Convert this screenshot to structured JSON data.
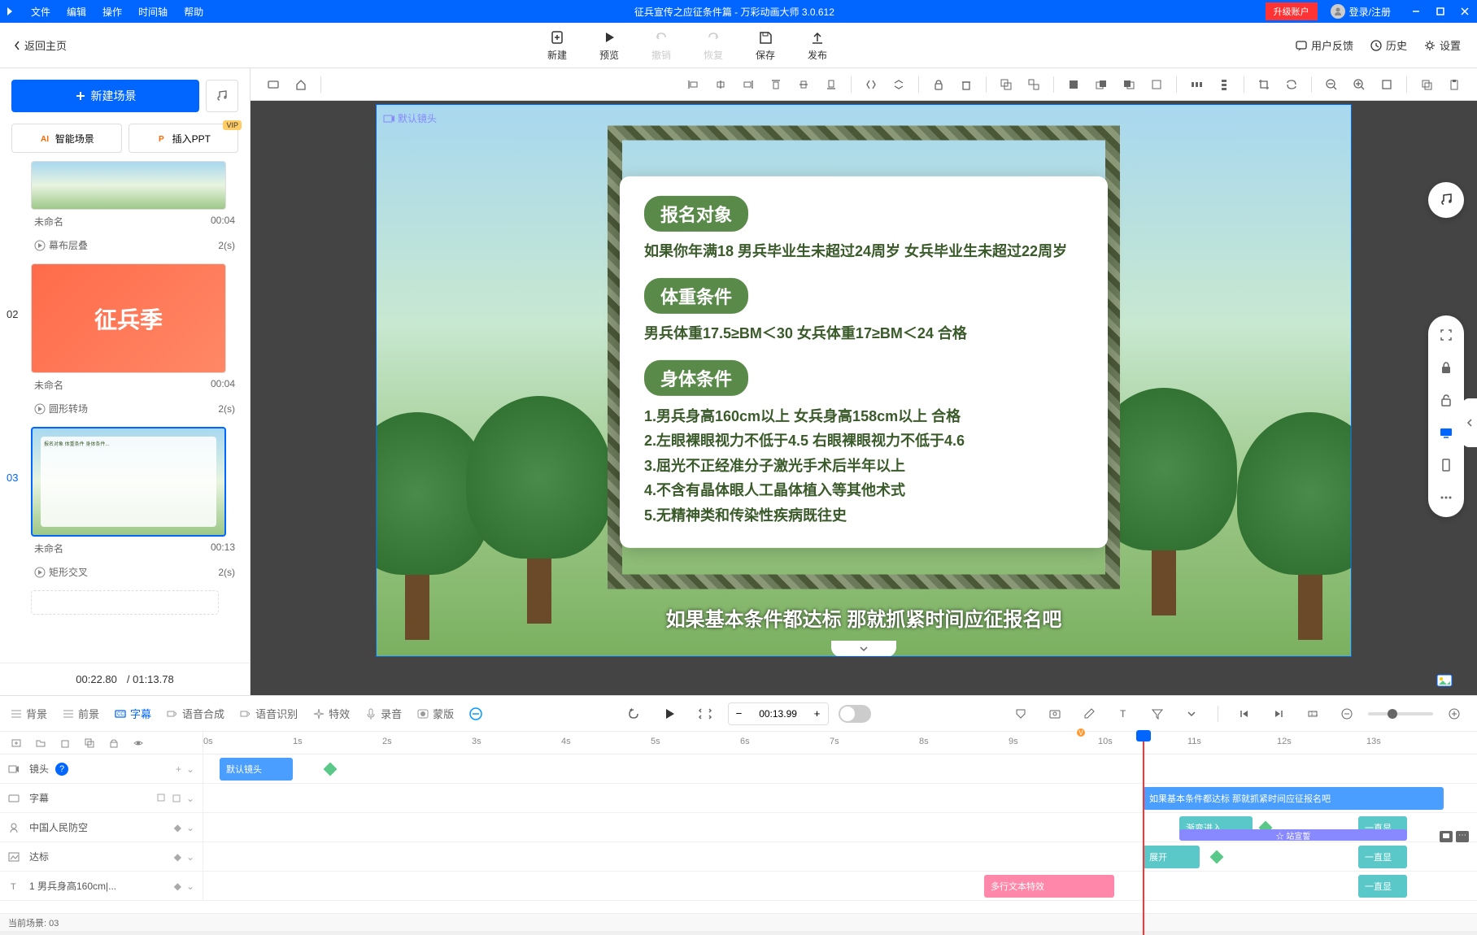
{
  "titlebar": {
    "menus": [
      "文件",
      "编辑",
      "操作",
      "时间轴",
      "帮助"
    ],
    "title": "征兵宣传之应征条件篇 - 万彩动画大师 3.0.612",
    "upgrade": "升级账户",
    "login": "登录/注册"
  },
  "back_home": "返回主页",
  "main_toolbar": {
    "new": "新建",
    "preview": "预览",
    "undo": "撤销",
    "redo": "恢复",
    "save": "保存",
    "publish": "发布"
  },
  "toolbar_right": {
    "feedback": "用户反馈",
    "history": "历史",
    "settings": "设置"
  },
  "left_panel": {
    "new_scene": "新建场景",
    "smart_scene": "智能场景",
    "insert_ppt": "插入PPT",
    "vip": "VIP",
    "scenes": [
      {
        "num": "",
        "name": "未命名",
        "duration": "00:04",
        "transition": "幕布层叠",
        "trans_time": "2(s)"
      },
      {
        "num": "02",
        "name": "未命名",
        "duration": "00:04",
        "transition": "圆形转场",
        "trans_time": "2(s)",
        "banner": "征兵季"
      },
      {
        "num": "03",
        "name": "未命名",
        "duration": "00:13",
        "transition": "矩形交叉",
        "trans_time": "2(s)",
        "selected": true
      }
    ],
    "current_time": "00:22.80",
    "total_time": "/ 01:13.78"
  },
  "canvas": {
    "camera_label": "默认镜头",
    "card": {
      "section1_title": "报名对象",
      "section1_text": "如果你年满18 男兵毕业生未超过24周岁 女兵毕业生未超过22周岁",
      "section2_title": "体重条件",
      "section2_text": "男兵体重17.5≥BM＜30 女兵体重17≥BM＜24 合格",
      "section3_title": "身体条件",
      "section3_items": [
        "1.男兵身高160cm以上 女兵身高158cm以上 合格",
        "2.左眼裸眼视力不低于4.5 右眼裸眼视力不低于4.6",
        "3.屈光不正经准分子激光手术后半年以上",
        "4.不含有晶体眼人工晶体植入等其他术式",
        "5.无精神类和传染性疾病既往史"
      ]
    },
    "subtitle": "如果基本条件都达标 那就抓紧时间应征报名吧"
  },
  "bottom": {
    "tabs": {
      "background": "背景",
      "foreground": "前景",
      "subtitle": "字幕",
      "tts": "语音合成",
      "asr": "语音识别",
      "effect": "特效",
      "record": "录音",
      "mask": "蒙版"
    },
    "time_value": "00:13.99",
    "ruler_ticks": [
      "0s",
      "1s",
      "2s",
      "3s",
      "4s",
      "5s",
      "6s",
      "7s",
      "8s",
      "9s",
      "10s",
      "11s",
      "12s",
      "13s"
    ],
    "tracks": {
      "camera": {
        "label": "镜头",
        "clip": "默认镜头"
      },
      "subtitle": {
        "label": "字幕",
        "clip": "如果基本条件都达标 那就抓紧时间应征报名吧"
      },
      "audio": {
        "label": "中国人民防空",
        "clip1": "渐变进入",
        "clip2": "☆ 站宣誓",
        "clip3": "一直显"
      },
      "target": {
        "label": "达标",
        "clip1": "展开",
        "clip2": "一直显"
      },
      "text": {
        "label": "1 男兵身高160cm|...",
        "clip1": "多行文本特效",
        "clip2": "一直显"
      }
    },
    "status": "当前场景: 03"
  }
}
